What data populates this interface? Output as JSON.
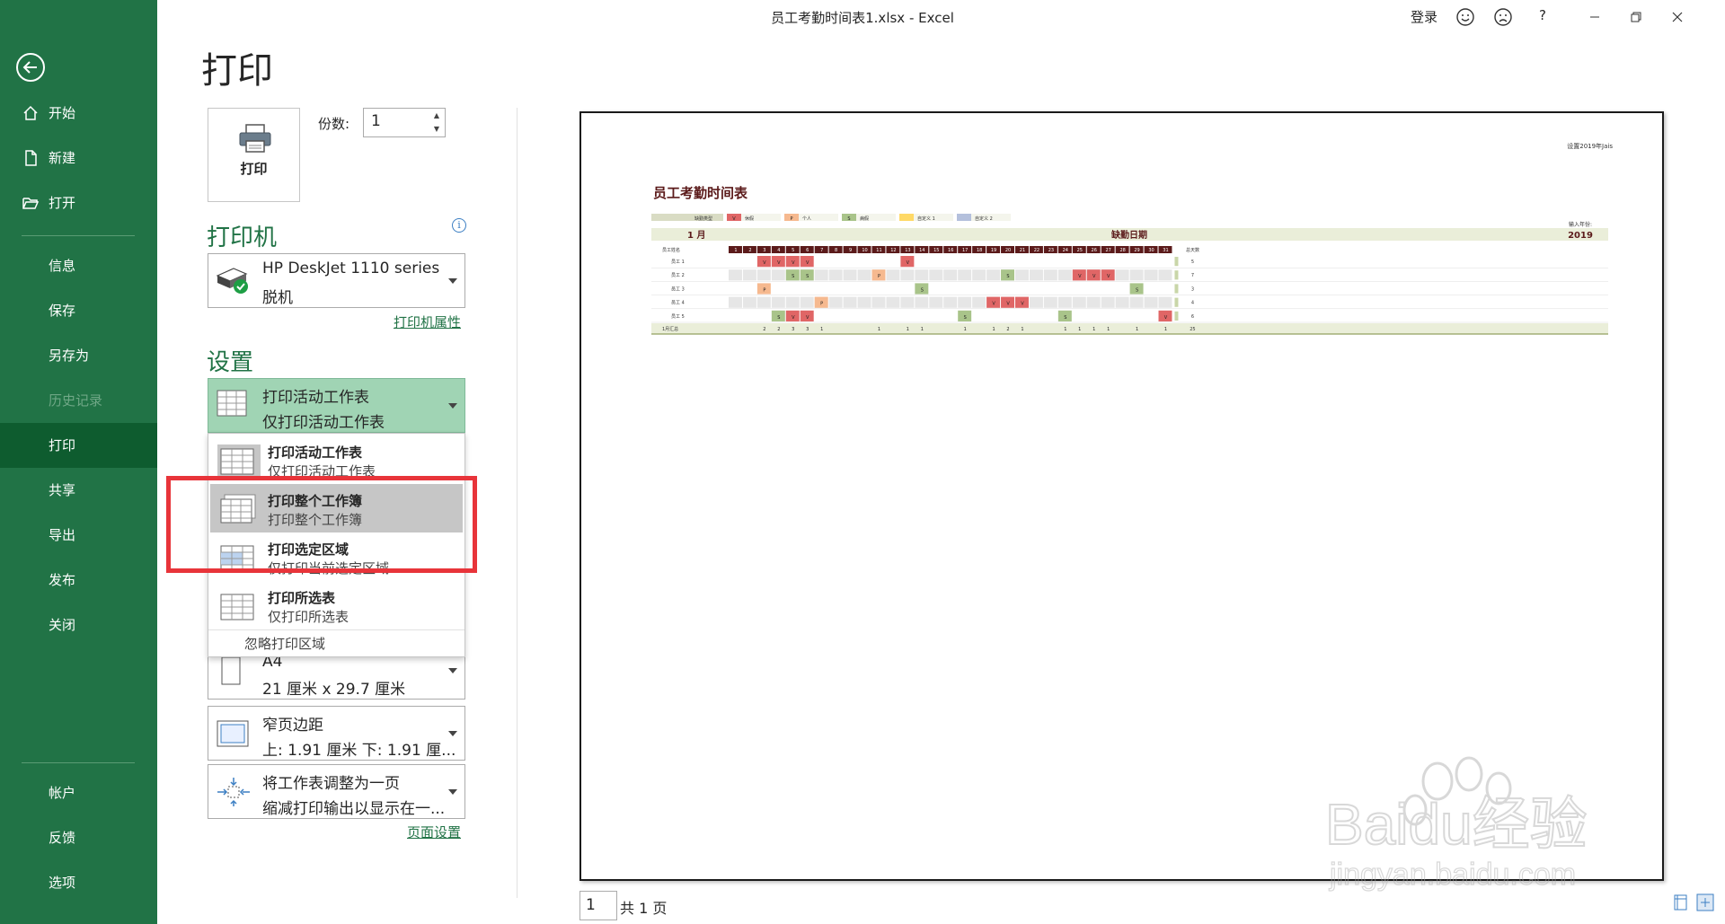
{
  "window": {
    "title": "员工考勤时间表1.xlsx  -  Excel",
    "login": "登录",
    "help": "?"
  },
  "nav": {
    "items": [
      {
        "label": "开始",
        "icon": "home-icon"
      },
      {
        "label": "新建",
        "icon": "new-file-icon"
      },
      {
        "label": "打开",
        "icon": "open-folder-icon"
      },
      {
        "label": "信息"
      },
      {
        "label": "保存"
      },
      {
        "label": "另存为"
      },
      {
        "label": "历史记录",
        "disabled": true
      },
      {
        "label": "打印",
        "active": true
      },
      {
        "label": "共享"
      },
      {
        "label": "导出"
      },
      {
        "label": "发布"
      },
      {
        "label": "关闭"
      },
      {
        "label": "帐户"
      },
      {
        "label": "反馈"
      },
      {
        "label": "选项"
      }
    ]
  },
  "print": {
    "title": "打印",
    "button_label": "打印",
    "copies_label": "份数:",
    "copies_value": "1",
    "printer_heading": "打印机",
    "printer_name": "HP DeskJet 1110 series",
    "printer_status": "脱机",
    "printer_properties": "打印机属性",
    "settings_heading": "设置",
    "scope_selected": {
      "title": "打印活动工作表",
      "subtitle": "仅打印活动工作表"
    },
    "scope_menu": [
      {
        "title": "打印活动工作表",
        "subtitle": "仅打印活动工作表"
      },
      {
        "title": "打印整个工作簿",
        "subtitle": "打印整个工作簿"
      },
      {
        "title": "打印选定区域",
        "subtitle": "仅打印当前选定区域"
      },
      {
        "title": "打印所选表",
        "subtitle": "仅打印所选表"
      }
    ],
    "ignore_print_area": "忽略打印区域",
    "paper": {
      "title": "A4",
      "subtitle": "21 厘米 x 29.7 厘米"
    },
    "margins": {
      "title": "窄页边距",
      "subtitle": "上: 1.91 厘米 下: 1.91 厘..."
    },
    "scaling": {
      "title": "将工作表调整为一页",
      "subtitle": "缩减打印输出以显示在一..."
    },
    "page_setup": "页面设置"
  },
  "preview": {
    "page_value": "1",
    "page_total": "共 1 页",
    "header_right": "设置2019年Jais",
    "sheet_title": "员工考勤时间表",
    "legend": [
      {
        "label": "缺勤类型",
        "code": "",
        "color": "#d9dcc4"
      },
      {
        "label": "休假",
        "code": "V",
        "color": "#e06666"
      },
      {
        "label": "个人",
        "code": "P",
        "color": "#f6b98f"
      },
      {
        "label": "病假",
        "code": "S",
        "color": "#a9c48a"
      },
      {
        "label": "自定义 1",
        "code": "",
        "color": "#ffd966"
      },
      {
        "label": "自定义 2",
        "code": "",
        "color": "#b4c0dc"
      }
    ],
    "month": "1 月",
    "absence_header": "缺勤日期",
    "year_label": "输入年份:",
    "year": "2019",
    "employee_col": "员工姓名",
    "total_col": "总天数",
    "employees": [
      "员工 1",
      "员工 2",
      "员工 3",
      "员工 4",
      "员工 5"
    ],
    "totals": [
      "5",
      "7",
      "3",
      "4",
      "6"
    ],
    "summary_label": "1月汇总",
    "summary_total": "25",
    "day_labels": [
      "1",
      "2",
      "3",
      "4",
      "5",
      "6",
      "7",
      "8",
      "9",
      "10",
      "11",
      "12",
      "13",
      "14",
      "15",
      "16",
      "17",
      "18",
      "19",
      "20",
      "21",
      "22",
      "23",
      "24",
      "25",
      "26",
      "27",
      "28",
      "29",
      "30",
      "31"
    ],
    "marks": [
      [
        [
          3,
          "V"
        ],
        [
          4,
          "V"
        ],
        [
          5,
          "V"
        ],
        [
          6,
          "V"
        ],
        [
          13,
          "V"
        ]
      ],
      [
        [
          5,
          "S"
        ],
        [
          6,
          "S"
        ],
        [
          11,
          "P"
        ],
        [
          20,
          "S"
        ],
        [
          25,
          "V"
        ],
        [
          26,
          "V"
        ],
        [
          27,
          "V"
        ]
      ],
      [
        [
          3,
          "P"
        ],
        [
          14,
          "S"
        ],
        [
          29,
          "S"
        ]
      ],
      [
        [
          7,
          "P"
        ],
        [
          19,
          "V"
        ],
        [
          20,
          "V"
        ],
        [
          21,
          "V"
        ]
      ],
      [
        [
          4,
          "S"
        ],
        [
          5,
          "V"
        ],
        [
          6,
          "V"
        ],
        [
          17,
          "S"
        ],
        [
          24,
          "S"
        ],
        [
          31,
          "V"
        ]
      ]
    ],
    "summary_counts": [
      [
        "3",
        "2"
      ],
      [
        "4",
        "2"
      ],
      [
        "5",
        "3"
      ],
      [
        "6",
        "3"
      ],
      [
        "7",
        "1"
      ],
      [
        "11",
        "1"
      ],
      [
        "13",
        "1"
      ],
      [
        "14",
        "1"
      ],
      [
        "17",
        "1"
      ],
      [
        "19",
        "1"
      ],
      [
        "20",
        "2"
      ],
      [
        "21",
        "1"
      ],
      [
        "24",
        "1"
      ],
      [
        "25",
        "1"
      ],
      [
        "26",
        "1"
      ],
      [
        "27",
        "1"
      ],
      [
        "29",
        "1"
      ],
      [
        "31",
        "1"
      ]
    ]
  },
  "watermark": {
    "brand": "Baidu经验",
    "url": "jingyan.baidu.com"
  },
  "colors": {
    "accent": "#217346",
    "nav_active": "#0e5c2f",
    "highlight": "#e8343a",
    "sheet_header": "#5b1a1a"
  }
}
